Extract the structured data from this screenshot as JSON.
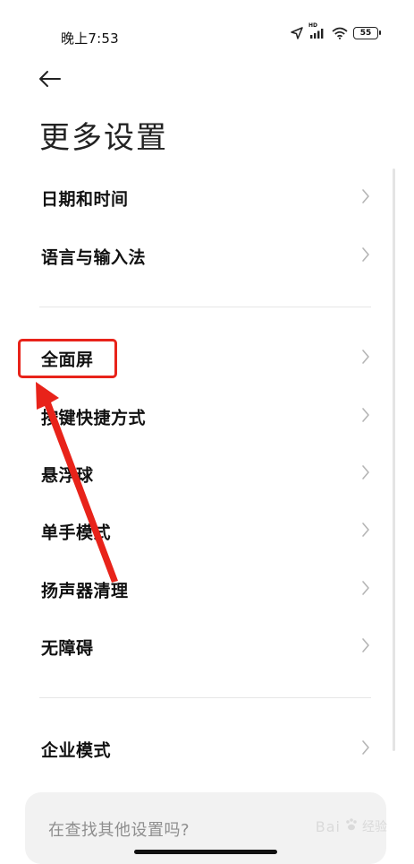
{
  "status_bar": {
    "time": "晚上7:53",
    "battery": "55",
    "network_badge": "HD"
  },
  "header": {
    "title": "更多设置"
  },
  "sections": [
    {
      "items": [
        {
          "label": "日期和时间"
        },
        {
          "label": "语言与输入法"
        }
      ]
    },
    {
      "items": [
        {
          "label": "全面屏",
          "highlighted": true
        },
        {
          "label": "按键快捷方式"
        },
        {
          "label": "悬浮球"
        },
        {
          "label": "单手模式"
        },
        {
          "label": "扬声器清理"
        },
        {
          "label": "无障碍"
        }
      ]
    },
    {
      "items": [
        {
          "label": "企业模式"
        }
      ]
    }
  ],
  "search_card": {
    "text": "在查找其他设置吗?"
  },
  "watermark": {
    "brand": "Bai",
    "sub": "经验"
  },
  "colors": {
    "annotation_red": "#e8231a",
    "chevron": "#b5b5b5",
    "divider": "#e6e6e6",
    "card_bg": "#f2f2f2"
  },
  "icons": {
    "back": "arrow-left-icon",
    "chevron": "chevron-right-icon",
    "location": "location-arrow-icon",
    "signal": "signal-icon",
    "wifi": "wifi-icon"
  }
}
